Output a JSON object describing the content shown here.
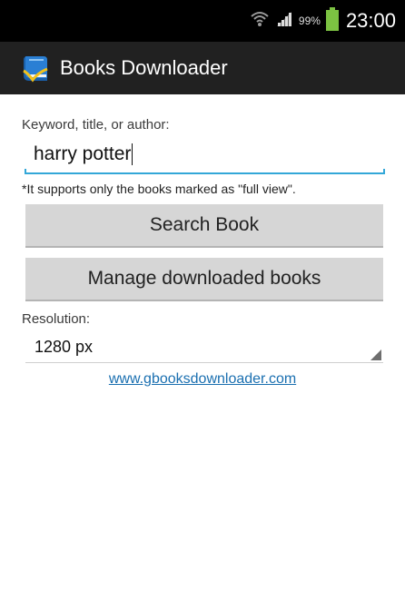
{
  "status_bar": {
    "battery_percent": "99%",
    "time": "23:00",
    "icons": [
      "wifi-icon",
      "signal-icon",
      "battery-icon"
    ],
    "battery_color": "#7cc242"
  },
  "action_bar": {
    "title": "Books Downloader",
    "icon": "book-app-icon"
  },
  "form": {
    "keyword_label": "Keyword, title, or author:",
    "search_value": "harry potter",
    "note": "*It supports only the books marked as \"full view\".",
    "search_button": "Search Book",
    "manage_button": "Manage downloaded books",
    "resolution_label": "Resolution:",
    "resolution_value": "1280 px",
    "link_text": "www.gbooksdownloader.com"
  },
  "colors": {
    "accent": "#33a7d8",
    "link": "#1a6fb0",
    "button_bg": "#d6d6d6"
  }
}
